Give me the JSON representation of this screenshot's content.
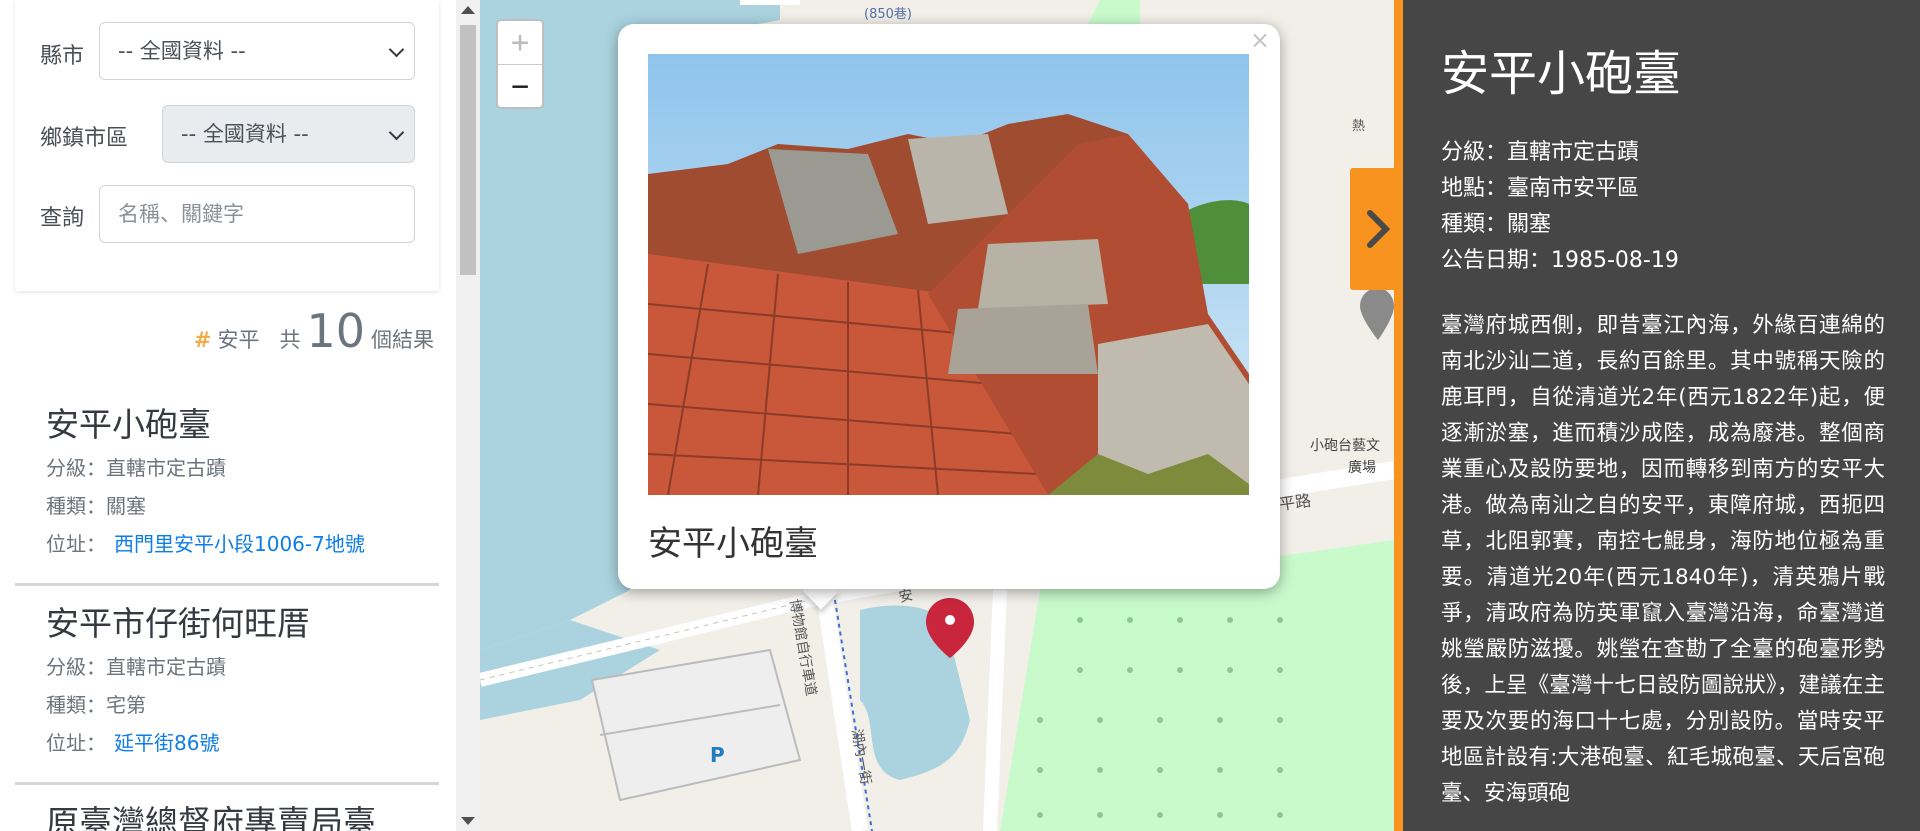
{
  "filters": {
    "county_label": "縣市",
    "county_value": "-- 全國資料 --",
    "township_label": "鄉鎮市區",
    "township_value": "-- 全國資料 --",
    "query_label": "查詢",
    "query_placeholder": "名稱、關鍵字"
  },
  "summary": {
    "hash": "#",
    "keyword": "安平",
    "prefix": "共",
    "count": "10",
    "suffix": "個結果"
  },
  "results": [
    {
      "title": "安平小砲臺",
      "grade": "分級：直轄市定古蹟",
      "category": "種類：關塞",
      "address_label": "位址：",
      "address": "西門里安平小段1006-7地號"
    },
    {
      "title": "安平市仔街何旺厝",
      "grade": "分級：直轄市定古蹟",
      "category": "種類：宅第",
      "address_label": "位址：",
      "address": "延平街86號"
    },
    {
      "title": "原臺灣總督府專賣局臺"
    }
  ],
  "map": {
    "zoom_in": "+",
    "zoom_out": "−",
    "labels": {
      "lane": "(850巷)",
      "plaza_line1": "小砲台藝文",
      "plaza_line2": "廣場",
      "road": "平路",
      "bike_path": "博物館自行車道",
      "lane2": "湖內一街",
      "an": "安",
      "parking": "P",
      "heat": "熱"
    },
    "colors": {
      "water": "#aad3df",
      "park": "#c8facc",
      "land": "#f2efe9",
      "marker": "#c9253c"
    },
    "popup": {
      "close": "×",
      "title": "安平小砲臺"
    }
  },
  "detail": {
    "title": "安平小砲臺",
    "grade": "分級：直轄市定古蹟",
    "location": "地點：臺南市安平區",
    "category": "種類：關塞",
    "date": "公告日期：1985-08-19",
    "description": "臺灣府城西側，即昔臺江內海，外緣百連綿的南北沙汕二道，長約百餘里。其中號稱天險的鹿耳門，自從清道光2年(西元1822年)起，便逐漸淤塞，進而積沙成陸，成為廢港。整個商業重心及設防要地，因而轉移到南方的安平大港。做為南汕之自的安平，東障府城，西扼四草，北阻郭賽，南控七鯤身，海防地位極為重要。清道光20年(西元1840年)，清英鴉片戰爭，清政府為防英軍竄入臺灣沿海，命臺灣道姚瑩嚴防滋擾。姚瑩在查勘了全臺的砲臺形勢後，上呈《臺灣十七日設防圖說狀》，建議在主要及次要的海口十七處，分別設防。當時安平地區計設有:大港砲臺、紅毛城砲臺、天后宮砲臺、安海頭砲"
  },
  "theme": {
    "accent": "#f7931e",
    "panel_bg": "#464646",
    "link": "#0d7ee6"
  }
}
